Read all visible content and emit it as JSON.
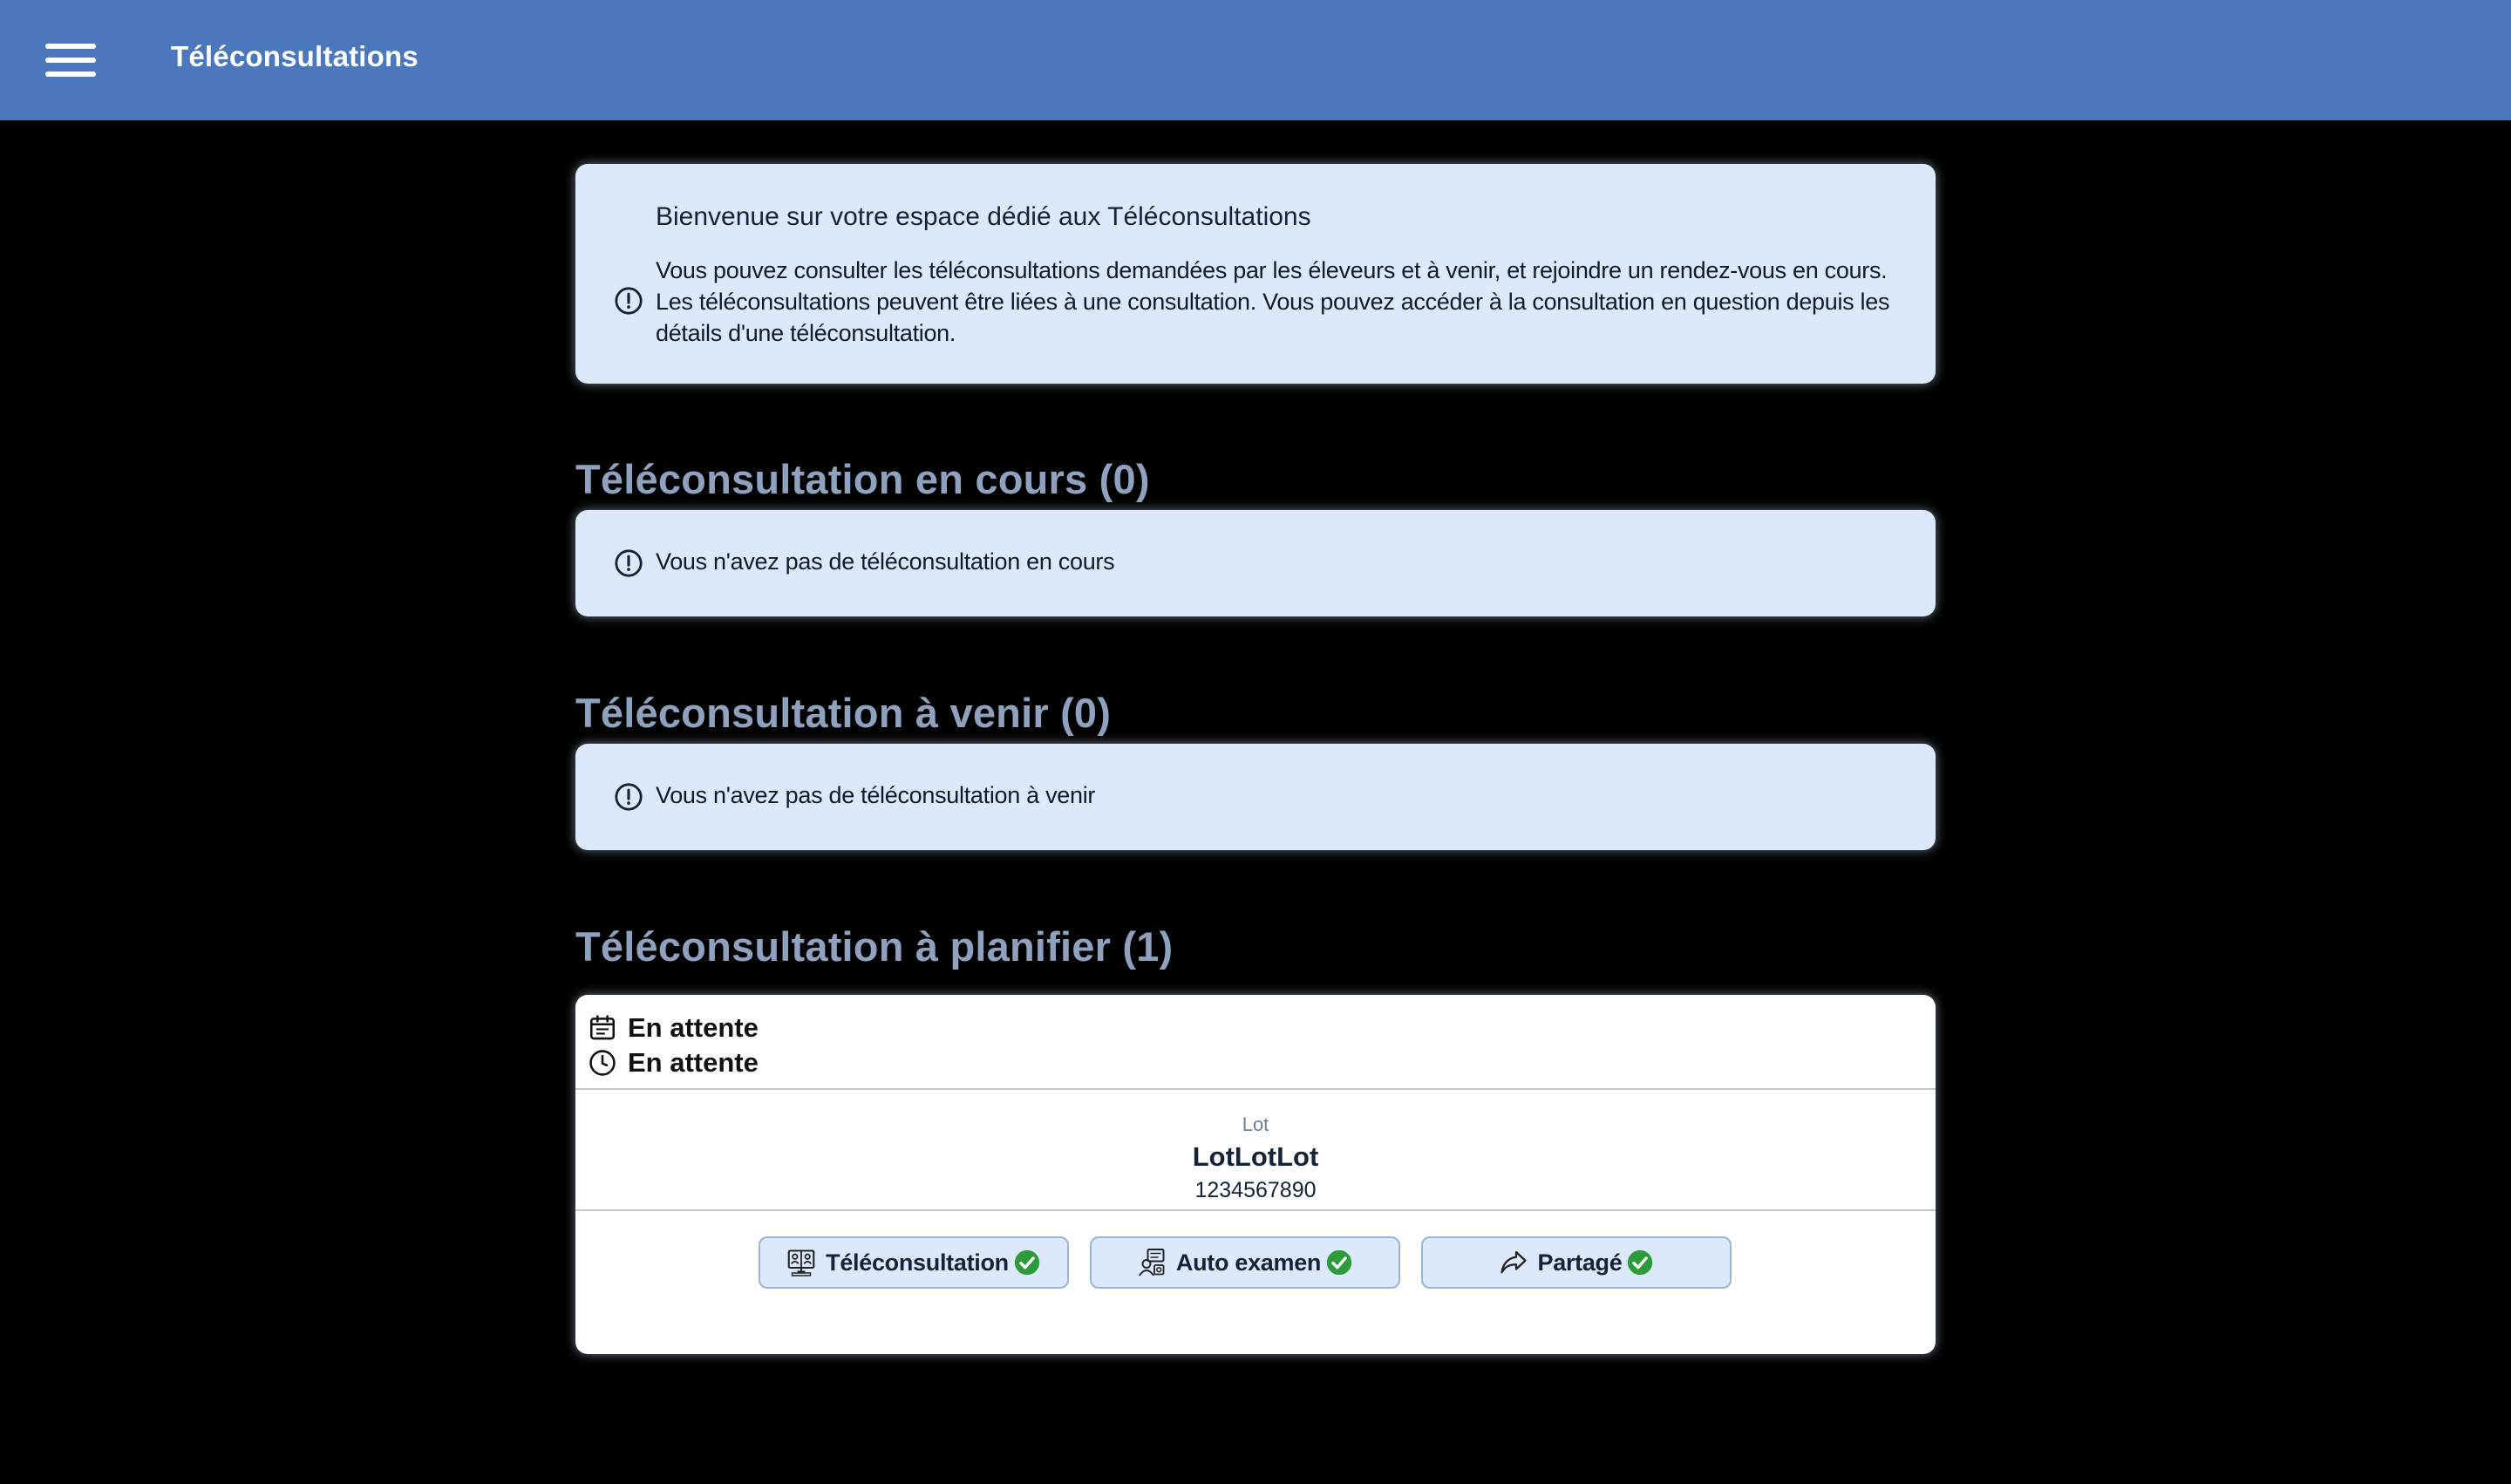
{
  "header": {
    "title": "Téléconsultations",
    "menu_icon": "hamburger-menu-icon"
  },
  "welcome": {
    "title": "Bienvenue sur votre espace dédié aux Téléconsultations",
    "text": "Vous pouvez consulter les téléconsultations demandées par les éleveurs et à venir, et rejoindre un rendez-vous en cours. Les téléconsultations peuvent être liées à une consultation. Vous pouvez accéder à la consultation en question depuis les détails d'une téléconsultation."
  },
  "sections": {
    "ongoing": {
      "title": "Téléconsultation en cours (0)",
      "empty_text": "Vous n'avez pas de téléconsultation en cours"
    },
    "upcoming": {
      "title": "Téléconsultation à venir (0)",
      "empty_text": "Vous n'avez pas de téléconsultation à venir"
    },
    "to_plan": {
      "title": "Téléconsultation à planifier (1)",
      "card": {
        "date_status": "En attente",
        "time_status": "En attente",
        "lot_label": "Lot",
        "lot_name": "LotLotLot",
        "lot_id": "1234567890",
        "actions": [
          {
            "label": "Téléconsultation",
            "icon": "video-consult-icon",
            "checked": true
          },
          {
            "label": "Auto examen",
            "icon": "self-exam-icon",
            "checked": true
          },
          {
            "label": "Partagé",
            "icon": "share-icon",
            "checked": true
          }
        ]
      }
    }
  },
  "colors": {
    "header_bg": "#4b77bc",
    "info_bg": "#dbe9fb",
    "section_title": "#8ea1be",
    "check_green": "#2e9b3a"
  }
}
